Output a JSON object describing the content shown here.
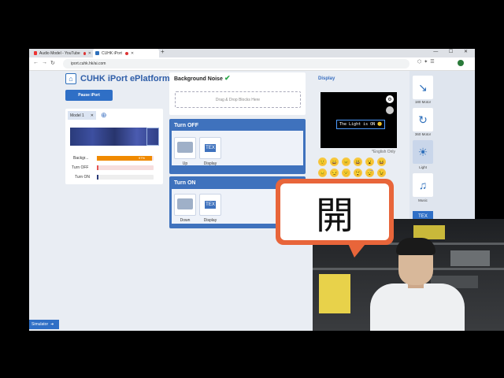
{
  "browser": {
    "tabs": [
      {
        "label": "Audio Model - YouTube",
        "recording": true
      },
      {
        "label": "CUHK iPort",
        "recording": true
      }
    ],
    "url": "iport.cuhk.hk/ai.com",
    "new_tab_symbol": "+",
    "window_controls": "— ☐ ✕"
  },
  "app": {
    "title": "CUHK iPort ePlatform",
    "pause_button": "Pause iPort",
    "simulator_button": "Simulator",
    "model": {
      "tab_label": "Model 1",
      "classes": [
        {
          "label": "Backgr...",
          "confidence": 0.97,
          "percent_text": "97%",
          "color": "#f08a00"
        },
        {
          "label": "Turn OFF",
          "confidence": 0.03,
          "color": "#e55555"
        },
        {
          "label": "Turn ON",
          "confidence": 0.0,
          "color": "#2a3b7a"
        }
      ]
    },
    "rules": {
      "noise_title": "Background Noise",
      "drop_hint": "Drag & Drop Blocks Here",
      "turn_off": {
        "title": "Turn OFF",
        "blocks": [
          {
            "label": "Up"
          },
          {
            "label": "Display",
            "tex": "TEX"
          }
        ]
      },
      "turn_on": {
        "title": "Turn ON",
        "blocks": [
          {
            "label": "Down"
          },
          {
            "label": "Display",
            "tex": "TEX"
          }
        ]
      }
    },
    "display": {
      "title": "Display",
      "screen_text": "The Light is ON",
      "language_note": "*English Only",
      "emoji_rows": [
        [
          "🙂",
          "😀",
          "😐",
          "😃",
          "😮",
          "😆"
        ],
        [
          "😑",
          "😏",
          "😕",
          "😲",
          "😴",
          "😉"
        ]
      ]
    },
    "sidebar": [
      {
        "label": "180 Motor",
        "icon": "motor-180-icon"
      },
      {
        "label": "360 Motor",
        "icon": "motor-360-icon"
      },
      {
        "label": "Light",
        "icon": "light-icon"
      },
      {
        "label": "Music",
        "icon": "music-icon"
      },
      {
        "label": "TEX",
        "icon": "text-icon"
      }
    ]
  },
  "overlay": {
    "bubble_text": "開",
    "bubble_color": "#e8653a"
  }
}
